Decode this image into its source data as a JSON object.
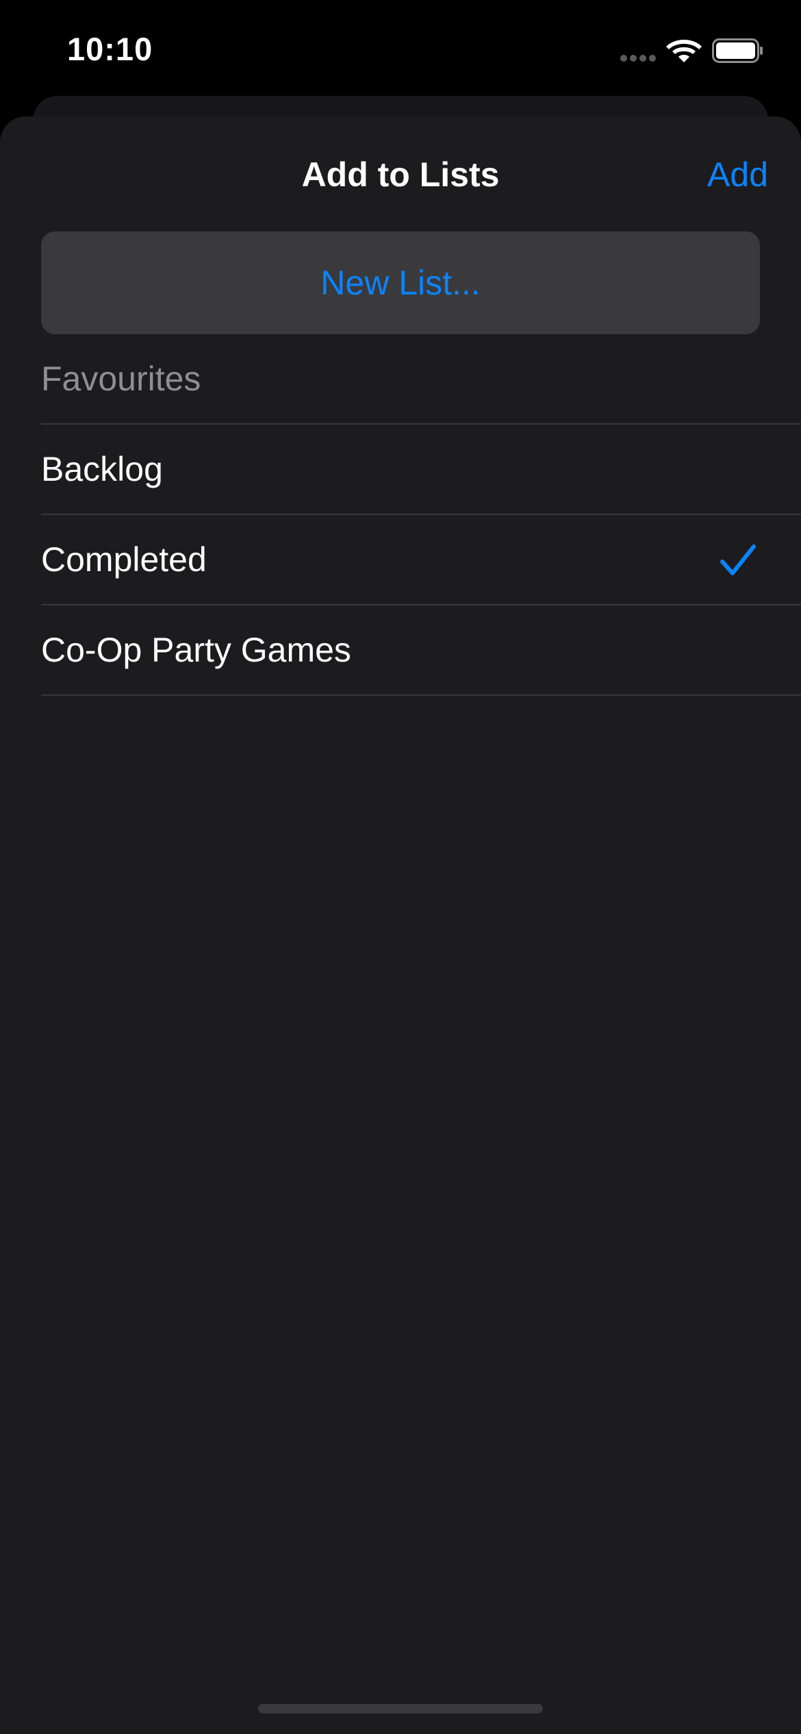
{
  "status_bar": {
    "time": "10:10",
    "icons": [
      "signal-dots-icon",
      "wifi-icon",
      "battery-icon"
    ]
  },
  "sheet": {
    "title": "Add to Lists",
    "add_label": "Add",
    "new_list_label": "New List..."
  },
  "lists": [
    {
      "label": "Favourites",
      "checked": false,
      "muted": true
    },
    {
      "label": "Backlog",
      "checked": false,
      "muted": false
    },
    {
      "label": "Completed",
      "checked": true,
      "muted": false
    },
    {
      "label": "Co-Op Party Games",
      "checked": false,
      "muted": false
    }
  ],
  "colors": {
    "accent": "#0a84ff",
    "sheet_background": "#1c1c1e",
    "button_background": "#3a3a3c",
    "separator": "#38383a",
    "muted_text": "#8e8e93"
  }
}
